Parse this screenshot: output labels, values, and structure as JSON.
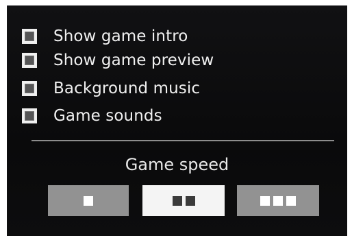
{
  "options": [
    {
      "label": "Show game intro",
      "checked": false
    },
    {
      "label": "Show game preview",
      "checked": false
    },
    {
      "label": "Background music",
      "checked": false
    },
    {
      "label": "Game sounds",
      "checked": false
    }
  ],
  "speed": {
    "title": "Game speed",
    "selected": "normal",
    "buttons": [
      {
        "id": "slow",
        "pips": 1
      },
      {
        "id": "normal",
        "pips": 2
      },
      {
        "id": "fast",
        "pips": 3
      }
    ]
  },
  "colors": {
    "panel_bg": "#0c0c0d",
    "text": "#f0f0f0",
    "button_inactive": "#929292",
    "button_active": "#f4f4f4"
  }
}
